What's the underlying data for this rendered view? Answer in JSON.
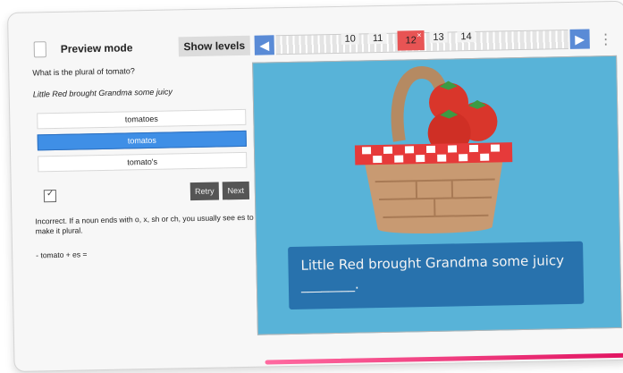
{
  "header": {
    "preview_label": "Preview mode",
    "show_levels_label": "Show levels",
    "levels": [
      "10",
      "11",
      "12",
      "13",
      "14"
    ],
    "current_level": "12",
    "current_level_mark": "×",
    "prev_icon": "◀",
    "next_icon": "▶",
    "menu_icon": "⋮"
  },
  "question": {
    "prompt": "What is the plural of tomato?",
    "sentence": "Little Red brought Grandma some juicy",
    "options": [
      "tomatoes",
      "tomatos",
      "tomato's"
    ],
    "selected_option": "tomatos"
  },
  "actions": {
    "retry_label": "Retry",
    "next_label": "Next"
  },
  "feedback": {
    "text": "Incorrect. If a noun ends with o, x, sh or ch, you usually see es to make it plural.",
    "formula": "- tomato + es ="
  },
  "scene": {
    "caption": "Little Red brought Grandma some juicy ________."
  },
  "colors": {
    "scene_bg": "#58b3d8",
    "caption_bg": "#2872ad",
    "selected_option": "#3f8fe6",
    "current_level": "#e85454",
    "nav_arrow": "#5a8bd6"
  }
}
